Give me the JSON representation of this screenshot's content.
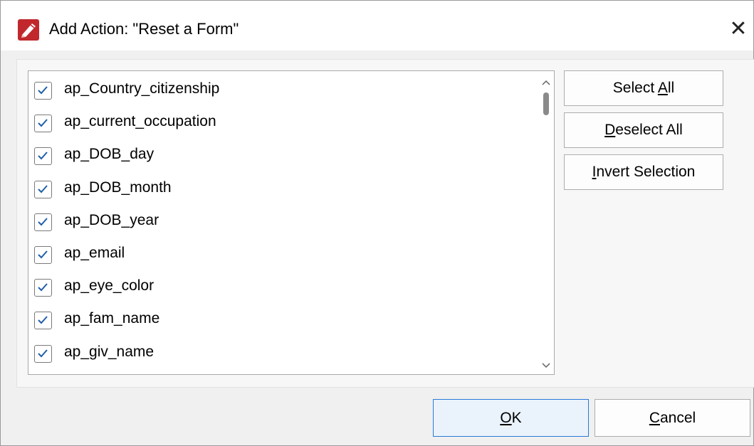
{
  "window": {
    "title": "Add Action: \"Reset a Form\"",
    "close_glyph": "✕",
    "app_icon": "pdf-editor-icon"
  },
  "fields": {
    "items": [
      {
        "label": "ap_Country_citizenship",
        "checked": true
      },
      {
        "label": "ap_current_occupation",
        "checked": true
      },
      {
        "label": "ap_DOB_day",
        "checked": true
      },
      {
        "label": "ap_DOB_month",
        "checked": true
      },
      {
        "label": "ap_DOB_year",
        "checked": true
      },
      {
        "label": "ap_email",
        "checked": true
      },
      {
        "label": "ap_eye_color",
        "checked": true
      },
      {
        "label": "ap_fam_name",
        "checked": true
      },
      {
        "label": "ap_giv_name",
        "checked": true
      }
    ]
  },
  "side_buttons": {
    "select_all": {
      "pre": "Select ",
      "key": "A",
      "post": "ll"
    },
    "deselect_all": {
      "pre": "",
      "key": "D",
      "post": "eselect All"
    },
    "invert_selection": {
      "pre": "",
      "key": "I",
      "post": "nvert Selection"
    }
  },
  "footer": {
    "ok": {
      "key": "O",
      "post": "K"
    },
    "cancel": {
      "key": "C",
      "post": "ancel"
    }
  },
  "colors": {
    "accent": "#2a7ad6",
    "checkmark": "#1f5fa8",
    "icon_red": "#c0282d"
  }
}
